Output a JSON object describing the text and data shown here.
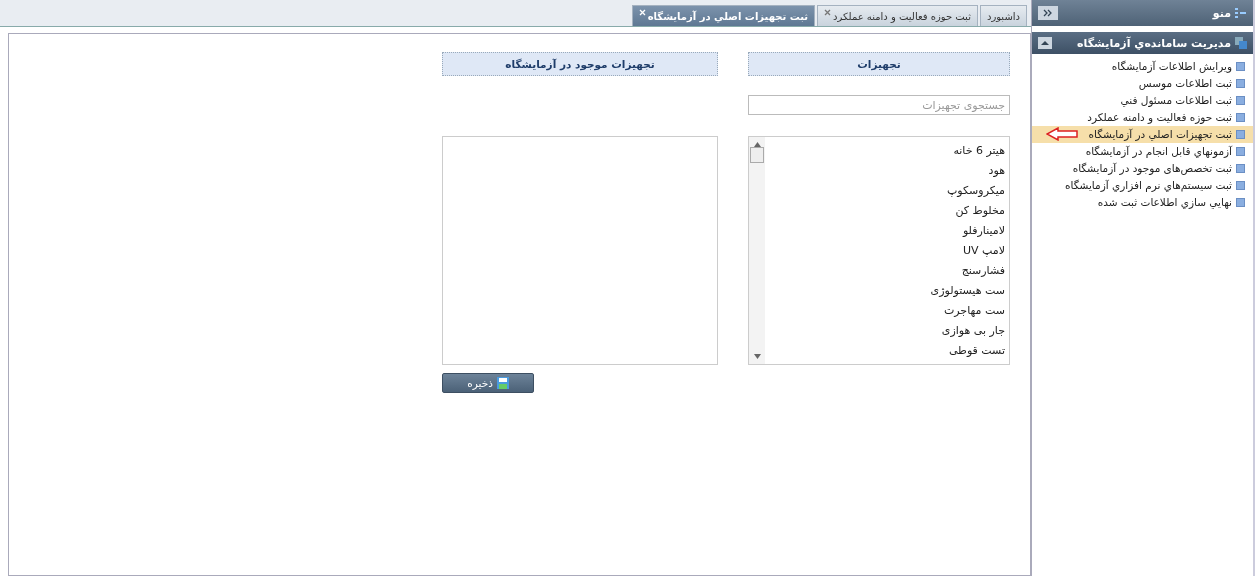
{
  "sidebar": {
    "title": "منو",
    "section": {
      "title": "مديريت سامانده‌ي آزمايشگاه",
      "items": [
        {
          "label": "ويرايش اطلاعات آزمايشگاه",
          "selected": false
        },
        {
          "label": "ثبت اطلاعات موسس",
          "selected": false
        },
        {
          "label": "ثبت اطلاعات مسئول فني",
          "selected": false
        },
        {
          "label": "ثبت حوزه فعالیت و دامنه عملکرد",
          "selected": false
        },
        {
          "label": "ثبت تجهيزات اصلي در آزمايشگاه",
          "selected": true
        },
        {
          "label": "آزمونهاي قابل انجام در آزمايشگاه",
          "selected": false
        },
        {
          "label": "ثبت تخصص‌های موجود در آزمايشگاه",
          "selected": false
        },
        {
          "label": "ثبت سيستم‌هاي نرم افزاري آزمايشگاه",
          "selected": false
        },
        {
          "label": "نهايي سازي اطلاعات ثبت شده",
          "selected": false
        }
      ]
    }
  },
  "tabs": [
    {
      "label": "داشبورد",
      "selected": false,
      "closable": false
    },
    {
      "label": "ثبت حوزه فعالیت و دامنه عملکرد",
      "selected": false,
      "closable": true
    },
    {
      "label": "ثبت تجهيزات اصلي در آزمايشگاه",
      "selected": true,
      "closable": true
    }
  ],
  "equipment": {
    "heading": "تجهیزات",
    "search": {
      "placeholder": "جستجوی تجهیزات"
    },
    "items": [
      "هیتر 6 خانه",
      "هود",
      "میکروسکوپ",
      "مخلوط کن",
      "لامینارفلو",
      "لامپ UV",
      "فشارسنج",
      "ست هیستولوژی",
      "ست مهاجرت",
      "جار بی هوازی",
      "تست قوطی"
    ]
  },
  "lab_equipment": {
    "heading": "تجهیزات موجود در آزمایشگاه"
  },
  "save_button": "ذخیره"
}
